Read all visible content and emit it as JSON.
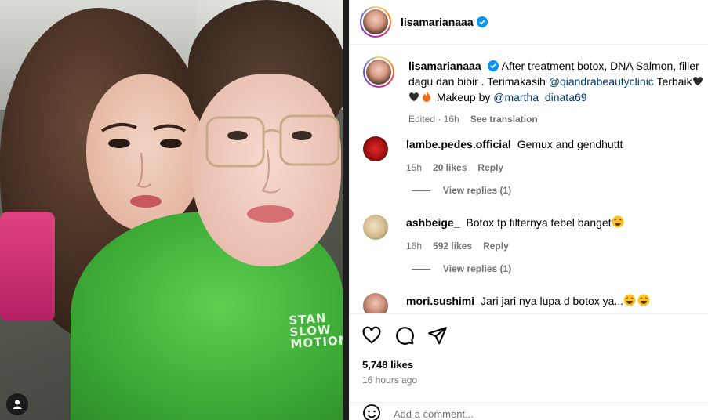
{
  "post": {
    "author": "lisamarianaaa",
    "caption": {
      "author": "lisamarianaaa",
      "text_before": "After treatment botox, DNA Salmon, filler dagu dan bibir . Terimakasih ",
      "mention1": "@qiandrabeautyclinic",
      "text_middle": " Terbaik",
      "text_after_emoji": " Makeup by ",
      "mention2": "@martha_dinata69",
      "edited": "Edited",
      "time": "16h",
      "see_translation": "See translation"
    },
    "image_shirt_text": "STAN\nSLOW\nMOTION"
  },
  "comments": [
    {
      "user": "lambe.pedes.official",
      "text": "Gemux and gendhuttt",
      "time": "15h",
      "likes": "20 likes",
      "reply": "Reply",
      "view_replies": "View replies (1)"
    },
    {
      "user": "ashbeige_",
      "text": "Botox tp filternya tebel banget",
      "time": "16h",
      "likes": "592 likes",
      "reply": "Reply",
      "view_replies": "View replies (1)"
    },
    {
      "user": "mori.sushimi",
      "text": "Jari jari nya lupa d botox ya...",
      "time": "",
      "likes": "",
      "reply": "",
      "view_replies": ""
    }
  ],
  "footer": {
    "likes": "5,748 likes",
    "posted": "16 hours ago",
    "add_comment_placeholder": "Add a comment..."
  },
  "colors": {
    "verified": "#0095f6",
    "mention": "#00376b",
    "muted": "#737373",
    "shirt": "#3fae38"
  },
  "icons": [
    "verified-icon",
    "heart-icon",
    "comment-icon",
    "share-icon",
    "emoji-icon",
    "user-tag-icon"
  ]
}
